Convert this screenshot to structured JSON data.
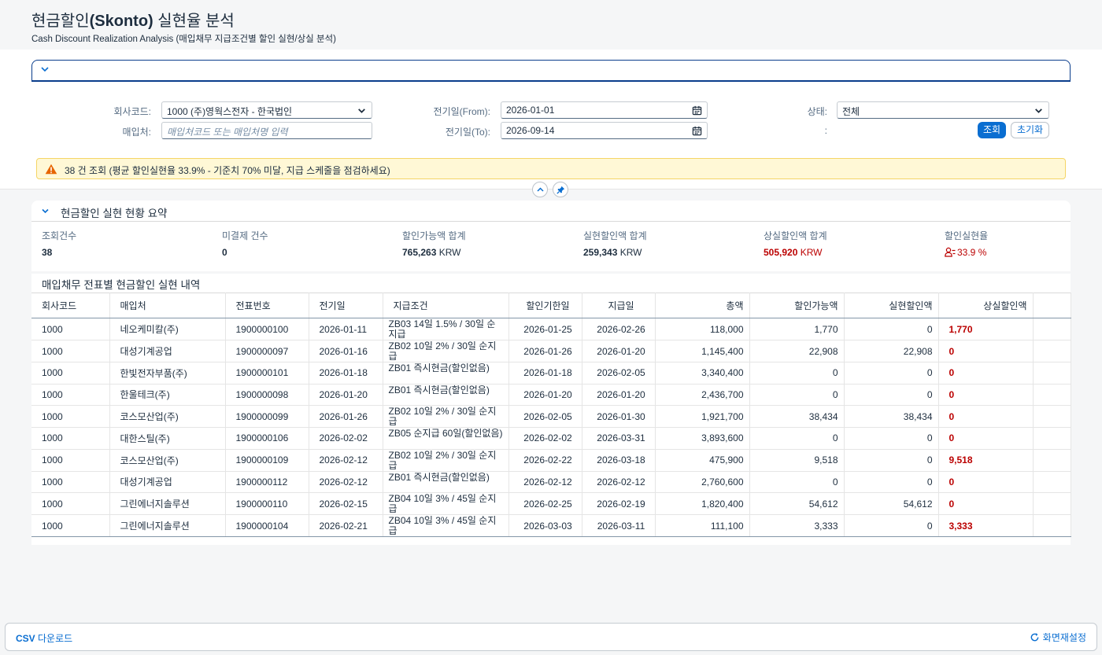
{
  "header": {
    "title_prefix": "현금할인",
    "title_brand": "(Skonto)",
    "title_suffix": " 실현율 분석",
    "subtitle": "Cash Discount Realization Analysis (매입채무 지급조건별 할인 실현/상실 분석)"
  },
  "filters": {
    "company_label": "회사코드:",
    "company_value": "1000 (주)영웍스전자 - 한국법인",
    "vendor_label": "매입처:",
    "vendor_placeholder": "매입처코드 또는 매입처명 입력",
    "date_from_label": "전기일(From):",
    "date_from_value": "2026-01-01",
    "date_to_label": "전기일(To):",
    "date_to_value": "2026-09-14",
    "status_label": "상태:",
    "status_value": "전체",
    "empty_label": ":",
    "search_button": "조회",
    "reset_button": "초기화"
  },
  "message": {
    "text": "38 건 조회 (평균 할인실현율 33.9% - 기준치 70% 미달, 지급 스케줄을 점검하세요)",
    "color": "#fff8d6"
  },
  "summary": {
    "title": "현금할인 실현 현황 요약",
    "kpis": [
      {
        "label": "조회건수",
        "value": "38",
        "unit": ""
      },
      {
        "label": "미결제 건수",
        "value": "0",
        "unit": ""
      },
      {
        "label": "할인가능액 합계",
        "value": "765,263",
        "unit": " KRW"
      },
      {
        "label": "실현할인액 합계",
        "value": "259,343",
        "unit": " KRW"
      },
      {
        "label": "상실할인액 합계",
        "value": "505,920",
        "unit": " KRW"
      },
      {
        "label": "할인실현율",
        "value": "33.9 %",
        "unit": ""
      }
    ]
  },
  "table": {
    "title": "매입채무 전표별 현금할인 실현 내역",
    "columns": [
      "회사코드",
      "매입처",
      "전표번호",
      "전기일",
      "지급조건",
      "할인기한일",
      "지급일",
      "총액",
      "할인가능액",
      "실현할인액",
      "상실할인액"
    ],
    "rows": [
      [
        "1000",
        "네오케미칼(주)",
        "1900000100",
        "2026-01-11",
        "ZB03 14일 1.5% / 30일 순지급",
        "2026-01-25",
        "2026-02-26",
        "118,000",
        "1,770",
        "0",
        "1,770"
      ],
      [
        "1000",
        "대성기계공업",
        "1900000097",
        "2026-01-16",
        "ZB02 10일 2% / 30일 순지급",
        "2026-01-26",
        "2026-01-20",
        "1,145,400",
        "22,908",
        "22,908",
        "0"
      ],
      [
        "1000",
        "한빛전자부품(주)",
        "1900000101",
        "2026-01-18",
        "ZB01 즉시현금(할인없음)",
        "2026-01-18",
        "2026-02-05",
        "3,340,400",
        "0",
        "0",
        "0"
      ],
      [
        "1000",
        "한울테크(주)",
        "1900000098",
        "2026-01-20",
        "ZB01 즉시현금(할인없음)",
        "2026-01-20",
        "2026-01-20",
        "2,436,700",
        "0",
        "0",
        "0"
      ],
      [
        "1000",
        "코스모산업(주)",
        "1900000099",
        "2026-01-26",
        "ZB02 10일 2% / 30일 순지급",
        "2026-02-05",
        "2026-01-30",
        "1,921,700",
        "38,434",
        "38,434",
        "0"
      ],
      [
        "1000",
        "대한스틸(주)",
        "1900000106",
        "2026-02-02",
        "ZB05 순지급 60일(할인없음)",
        "2026-02-02",
        "2026-03-31",
        "3,893,600",
        "0",
        "0",
        "0"
      ],
      [
        "1000",
        "코스모산업(주)",
        "1900000109",
        "2026-02-12",
        "ZB02 10일 2% / 30일 순지급",
        "2026-02-22",
        "2026-03-18",
        "475,900",
        "9,518",
        "0",
        "9,518"
      ],
      [
        "1000",
        "대성기계공업",
        "1900000112",
        "2026-02-12",
        "ZB01 즉시현금(할인없음)",
        "2026-02-12",
        "2026-02-12",
        "2,760,600",
        "0",
        "0",
        "0"
      ],
      [
        "1000",
        "그린에너지솔루션",
        "1900000110",
        "2026-02-15",
        "ZB04 10일 3% / 45일 순지급",
        "2026-02-25",
        "2026-02-19",
        "1,820,400",
        "54,612",
        "54,612",
        "0"
      ],
      [
        "1000",
        "그린에너지솔루션",
        "1900000104",
        "2026-02-21",
        "ZB04 10일 3% / 45일 순지급",
        "2026-03-03",
        "2026-03-11",
        "111,100",
        "3,333",
        "0",
        "3,333"
      ]
    ]
  },
  "footer": {
    "csv_bold": "CSV",
    "csv_rest": " 다운로드",
    "reset": "화면재설정"
  }
}
